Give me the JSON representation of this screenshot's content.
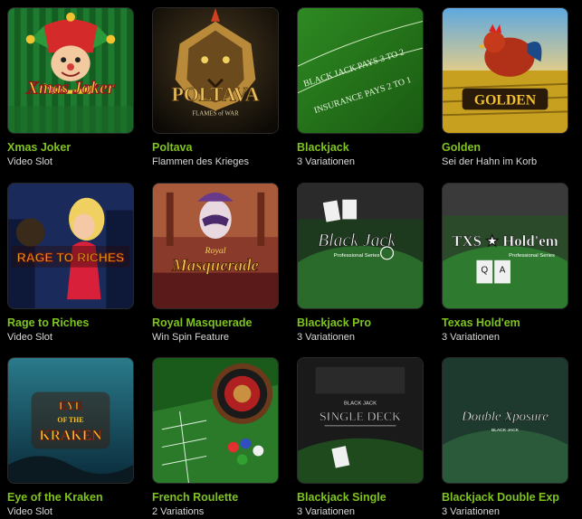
{
  "games": [
    {
      "title": "Xmas Joker",
      "subtitle": "Video Slot",
      "logo": "Xmas Joker"
    },
    {
      "title": "Poltava",
      "subtitle": "Flammen des Krieges",
      "logo": "POLTAVA",
      "logo_sub": "FLAMES of WAR"
    },
    {
      "title": "Blackjack",
      "subtitle": "3 Variationen",
      "logo": "BLACK JACK PAYS 3 TO 2",
      "logo_sub": "INSURANCE PAYS 2 TO 1"
    },
    {
      "title": "Golden",
      "subtitle": "Sei der Hahn im Korb",
      "logo": "GOLDEN"
    },
    {
      "title": "Rage to Riches",
      "subtitle": "Video Slot",
      "logo": "RAGE TO RICHES"
    },
    {
      "title": "Royal Masquerade",
      "subtitle": "Win Spin Feature",
      "logo": "Masquerade",
      "logo_sub": "Royal"
    },
    {
      "title": "Blackjack Pro",
      "subtitle": "3 Variationen",
      "logo": "Black Jack",
      "logo_sub": "Professional Series"
    },
    {
      "title": "Texas Hold'em",
      "subtitle": "3 Variationen",
      "logo": "TXS ★ Hold'em",
      "logo_sub": "Professional Series"
    },
    {
      "title": "Eye of the Kraken",
      "subtitle": "Video Slot",
      "logo": "EYE OF THE KRAKEN"
    },
    {
      "title": "French Roulette",
      "subtitle": "2 Variations",
      "logo": ""
    },
    {
      "title": "Blackjack Single",
      "subtitle": "3 Variationen",
      "logo": "SINGLE DECK",
      "logo_sub": "BLACK JACK"
    },
    {
      "title": "Blackjack Double Exp",
      "subtitle": "3 Variationen",
      "logo": "Double Xposure",
      "logo_sub": "BLACK JACK"
    }
  ],
  "colors": {
    "title": "#7fc41e",
    "subtitle": "#d8d8d8",
    "background": "#000000"
  }
}
